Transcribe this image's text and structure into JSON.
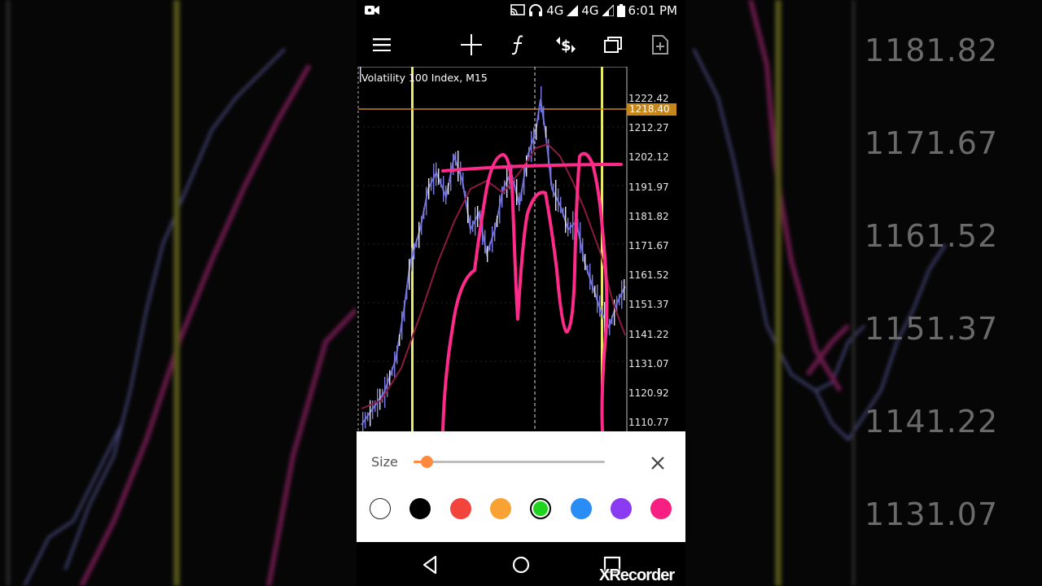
{
  "status_bar": {
    "network_1": "4G",
    "network_2": "4G",
    "time": "6:01 PM"
  },
  "toolbar": {
    "icons": [
      "menu-icon",
      "crosshair-icon",
      "function-icon",
      "symbol-change-icon",
      "windows-icon",
      "new-object-icon"
    ]
  },
  "chart": {
    "title": "Volatility 100 Index, M15",
    "current_price": "1218.40",
    "price_labels": [
      "1222.42",
      "1212.27",
      "1202.12",
      "1191.97",
      "1181.82",
      "1171.67",
      "1161.52",
      "1151.37",
      "1141.22",
      "1131.07",
      "1120.92",
      "1110.77"
    ],
    "colors": {
      "candles": "#6b6bd9",
      "moving_average": "#8a1a40",
      "vertical_lines": "#e8e86a",
      "current_line": "#c7861a",
      "drawing": "#ff2a8a"
    }
  },
  "background": {
    "left_prices": [],
    "right_prices": [
      "1181.82",
      "1171.67",
      "1161.52",
      "1151.37",
      "1141.22",
      "1131.07"
    ]
  },
  "drawing_panel": {
    "size_label": "Size",
    "size_value": 0.07,
    "colors": [
      {
        "name": "white",
        "hex": "#ffffff"
      },
      {
        "name": "black",
        "hex": "#000000"
      },
      {
        "name": "red",
        "hex": "#f2433d"
      },
      {
        "name": "orange",
        "hex": "#f7a233"
      },
      {
        "name": "green",
        "hex": "#1fd41f"
      },
      {
        "name": "blue",
        "hex": "#2a8cf5"
      },
      {
        "name": "purple",
        "hex": "#8a3af0"
      },
      {
        "name": "pink",
        "hex": "#f81f82"
      }
    ],
    "selected_color": "green"
  },
  "nav_bar": {
    "icons": [
      "back-icon",
      "home-icon",
      "recents-icon"
    ]
  },
  "watermark": "XRecorder"
}
